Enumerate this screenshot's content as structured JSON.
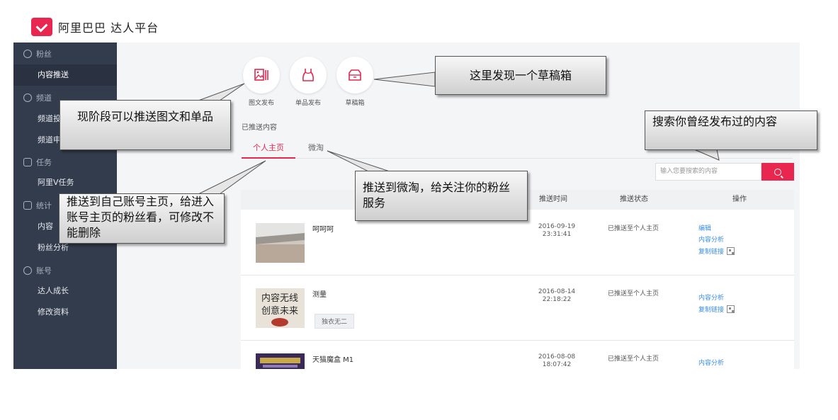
{
  "brand": {
    "name": "阿里巴巴 达人平台",
    "logo_icon": "alibaba-v-logo",
    "color": "#e8264f"
  },
  "sidebar": {
    "groups": [
      {
        "label": "粉丝",
        "icon": "fans-icon"
      },
      {
        "label": "频道",
        "icon": "compass-icon"
      },
      {
        "label": "任务",
        "icon": "task-icon"
      },
      {
        "label": "统计",
        "icon": "chart-icon"
      },
      {
        "label": "账号",
        "icon": "wrench-icon"
      }
    ],
    "items": [
      {
        "label": "内容推送",
        "active": true
      },
      {
        "label": "频道投"
      },
      {
        "label": "频道申"
      },
      {
        "label": "阿里V任务"
      },
      {
        "label": "内容"
      },
      {
        "label": "粉丝分析"
      },
      {
        "label": "达人成长"
      },
      {
        "label": "修改资料"
      }
    ]
  },
  "publish": [
    {
      "label": "图文发布",
      "icon": "image-text-icon"
    },
    {
      "label": "单品发布",
      "icon": "clothing-icon"
    },
    {
      "label": "草稿箱",
      "icon": "drafts-box-icon"
    }
  ],
  "pushed": {
    "title": "已推送内容",
    "tabs": [
      {
        "label": "个人主页",
        "active": true
      },
      {
        "label": "微淘"
      }
    ],
    "search": {
      "placeholder": "输入您要搜索的内容"
    },
    "columns": {
      "time": "推送时间",
      "status": "推送状态",
      "ops": "操作"
    },
    "rows": [
      {
        "title": "呵呵呵",
        "date": "2016-09-19",
        "time": "23:31:41",
        "status": "已推送至个人主页",
        "ops": [
          "编辑",
          "内容分析",
          "复制链接"
        ]
      },
      {
        "title": "测量",
        "tag": "独衣无二",
        "date": "2016-08-14",
        "time": "22:18:22",
        "status": "已推送至个人主页",
        "ops": [
          "内容分析",
          "复制链接"
        ],
        "thumb_text": [
          "内容无线",
          "创意未来"
        ]
      },
      {
        "title": "天猫魔盒 M1",
        "date": "2016-08-08",
        "time": "18:07:42",
        "status": "已推送至个人主页",
        "ops": [
          "内容分析"
        ]
      }
    ]
  },
  "callouts": [
    {
      "text": "这里发现一个草稿箱"
    },
    {
      "text": "现阶段可以推送图文和单品"
    },
    {
      "text": "搜索你曾经发布过的内容"
    },
    {
      "text": "推送到微淘，给关注你的粉丝服务"
    },
    {
      "text": "推送到自己账号主页，给进入账号主页的粉丝看，可修改不能删除"
    }
  ]
}
